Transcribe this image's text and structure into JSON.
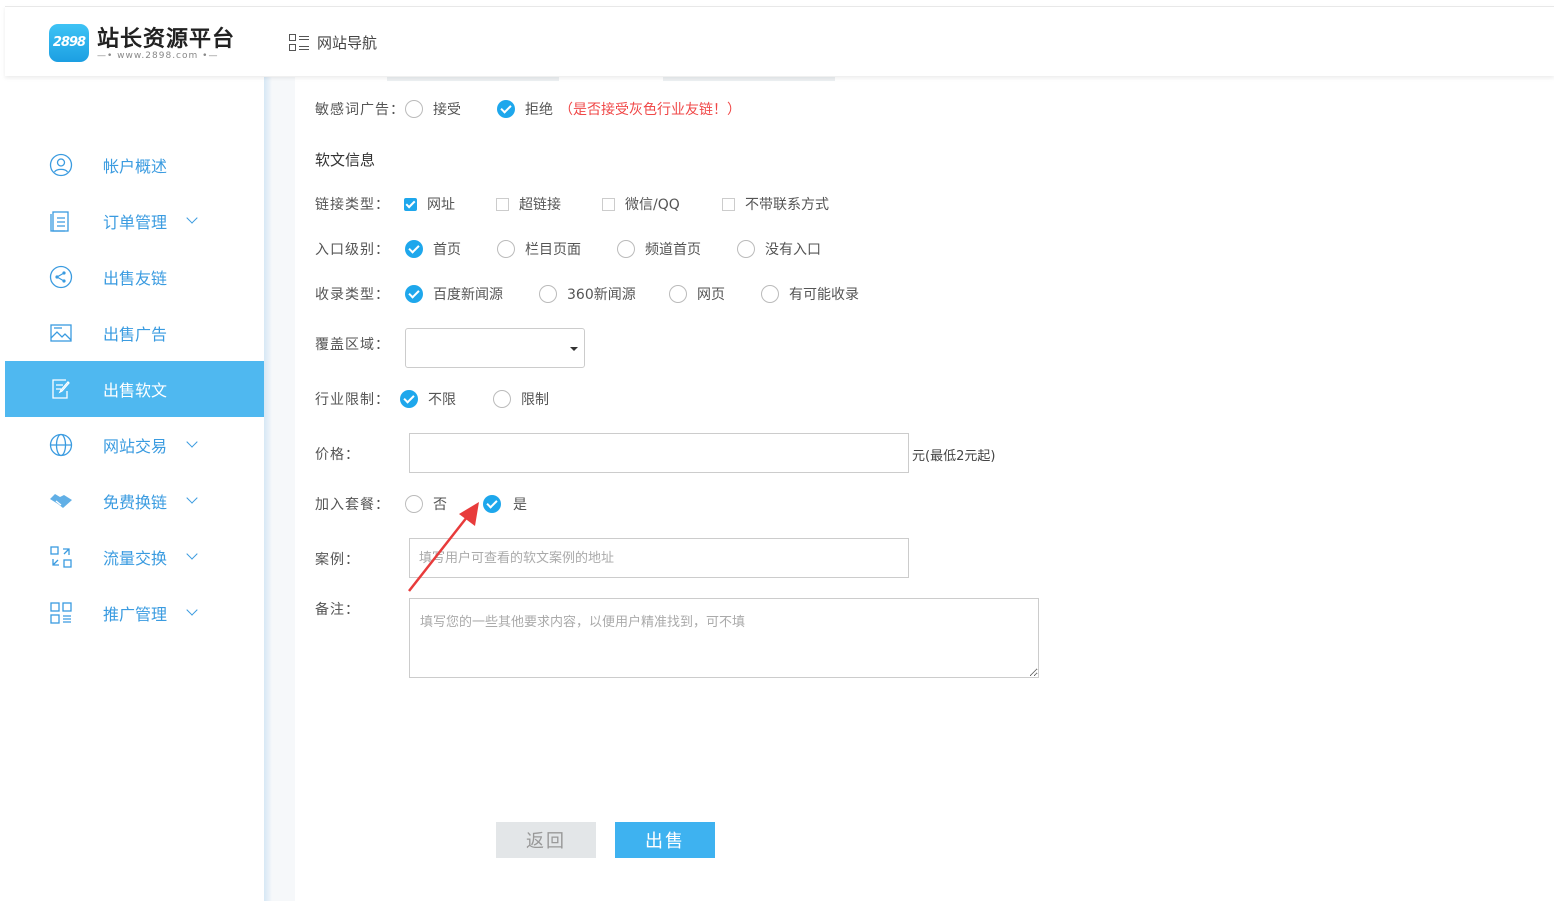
{
  "header": {
    "logo_badge": "2898",
    "logo_title": "站长资源平台",
    "logo_url": "—• www.2898.com •—",
    "nav_label": "网站导航"
  },
  "sidebar": {
    "items": [
      {
        "label": "帐户概述",
        "icon": "user-icon",
        "expandable": false,
        "active": false
      },
      {
        "label": "订单管理",
        "icon": "list-doc-icon",
        "expandable": true,
        "active": false
      },
      {
        "label": "出售友链",
        "icon": "share-icon",
        "expandable": false,
        "active": false
      },
      {
        "label": "出售广告",
        "icon": "image-icon",
        "expandable": false,
        "active": false
      },
      {
        "label": "出售软文",
        "icon": "edit-doc-icon",
        "expandable": false,
        "active": true
      },
      {
        "label": "网站交易",
        "icon": "globe-icon",
        "expandable": true,
        "active": false
      },
      {
        "label": "免费换链",
        "icon": "handshake-icon",
        "expandable": true,
        "active": false
      },
      {
        "label": "流量交换",
        "icon": "exchange-icon",
        "expandable": true,
        "active": false
      },
      {
        "label": "推广管理",
        "icon": "grid-icon",
        "expandable": true,
        "active": false
      }
    ]
  },
  "form": {
    "sensitive_ad": {
      "label": "敏感词广告：",
      "options": [
        "接受",
        "拒绝"
      ],
      "selected": 1,
      "note": "（是否接受灰色行业友链！）"
    },
    "section_title": "软文信息",
    "link_type": {
      "label": "链接类型：",
      "options": [
        "网址",
        "超链接",
        "微信/QQ",
        "不带联系方式"
      ],
      "checked": [
        true,
        false,
        false,
        false
      ]
    },
    "entry_level": {
      "label": "入口级别：",
      "options": [
        "首页",
        "栏目页面",
        "频道首页",
        "没有入口"
      ],
      "selected": 0
    },
    "index_type": {
      "label": "收录类型：",
      "options": [
        "百度新闻源",
        "360新闻源",
        "网页",
        "有可能收录"
      ],
      "selected": 0
    },
    "coverage": {
      "label": "覆盖区域：",
      "value": ""
    },
    "industry": {
      "label": "行业限制：",
      "options": [
        "不限",
        "限制"
      ],
      "selected": 0
    },
    "price": {
      "label": "价格：",
      "value": "",
      "suffix": "元(最低2元起)"
    },
    "package": {
      "label": "加入套餐：",
      "options": [
        "否",
        "是"
      ],
      "selected": 1
    },
    "case": {
      "label": "案例：",
      "placeholder": "填写用户可查看的软文案例的地址"
    },
    "remark": {
      "label": "备注：",
      "placeholder": "填写您的一些其他要求内容，以便用户精准找到，可不填"
    },
    "back_button": "返回",
    "sell_button": "出售"
  },
  "colors": {
    "accent": "#1ea7ec",
    "sidebar_active": "#4fb8f0",
    "warning": "#f04848",
    "annotation_arrow": "#e83b3b"
  }
}
